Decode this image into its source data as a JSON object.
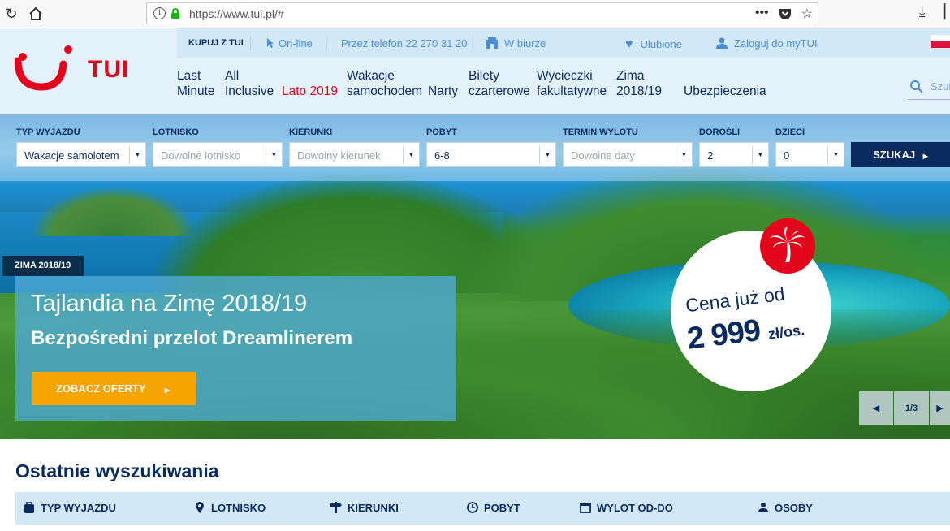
{
  "browser": {
    "url": "https://www.tui.pl/#",
    "back_icon": "reload-icon",
    "home_icon": "home-icon",
    "url_actions": [
      "more-icon",
      "pocket-icon",
      "bookmark-star-icon"
    ],
    "download_icon": "download-icon",
    "menu_icon": "library-icon"
  },
  "header": {
    "logo_text": "TUI",
    "topbar": {
      "buy_label": "KUPUJ Z TUI",
      "online": "On-line",
      "phone": "Przez telefon 22 270 31 20",
      "office": "W biurze",
      "favorites": "Ulubione",
      "login": "Zaloguj do myTUI"
    },
    "nav": [
      {
        "label": "Last\nMinute"
      },
      {
        "label": "All\nInclusive"
      },
      {
        "label": "Lato 2019"
      },
      {
        "label": "Wakacje\nsamochodem"
      },
      {
        "label": "Narty"
      },
      {
        "label": "Bilety\nczarterowe"
      },
      {
        "label": "Wycieczki\nfakultatywne"
      },
      {
        "label": "Zima\n2018/19"
      },
      {
        "label": "Ubezpieczenia"
      }
    ],
    "search_placeholder": "Szuk"
  },
  "search_form": {
    "fields": [
      {
        "label": "TYP WYJAZDU",
        "value": "Wakacje samolotem",
        "placeholder": false
      },
      {
        "label": "LOTNISKO",
        "value": "Dowolne lotnisko",
        "placeholder": true
      },
      {
        "label": "KIERUNKI",
        "value": "Dowolny kierunek",
        "placeholder": true
      },
      {
        "label": "POBYT",
        "value": "6-8",
        "placeholder": false
      },
      {
        "label": "TERMIN WYLOTU",
        "value": "Dowolne daty",
        "placeholder": true
      },
      {
        "label": "DOROŚLI",
        "value": "2",
        "placeholder": false
      },
      {
        "label": "DZIECI",
        "value": "0",
        "placeholder": false
      }
    ],
    "submit_label": "SZUKAJ"
  },
  "hero": {
    "season_tag": "ZIMA 2018/19",
    "title": "Tajlandia na Zimę 2018/19",
    "subtitle": "Bezpośredni przelot Dreamlinerem",
    "cta_label": "ZOBACZ OFERTY",
    "price_from": "Cena już od",
    "price_value": "2 999",
    "price_unit": "zł/os.",
    "slide_counter": "1/3"
  },
  "recent": {
    "title": "Ostatnie wyszukiwania",
    "columns": [
      {
        "label": "TYP WYJAZDU",
        "icon": "suitcase-icon"
      },
      {
        "label": "LOTNISKO",
        "icon": "location-pin-icon"
      },
      {
        "label": "KIERUNKI",
        "icon": "signpost-icon"
      },
      {
        "label": "POBYT",
        "icon": "clock-icon"
      },
      {
        "label": "WYLOT OD-DO",
        "icon": "calendar-icon"
      },
      {
        "label": "OSOBY",
        "icon": "people-icon"
      }
    ]
  },
  "colors": {
    "brand_red": "#e3051b",
    "brand_navy": "#092a5e",
    "accent_orange": "#f5a400",
    "link_blue": "#4a8ed1",
    "header_bg": "#e3f1fa"
  }
}
